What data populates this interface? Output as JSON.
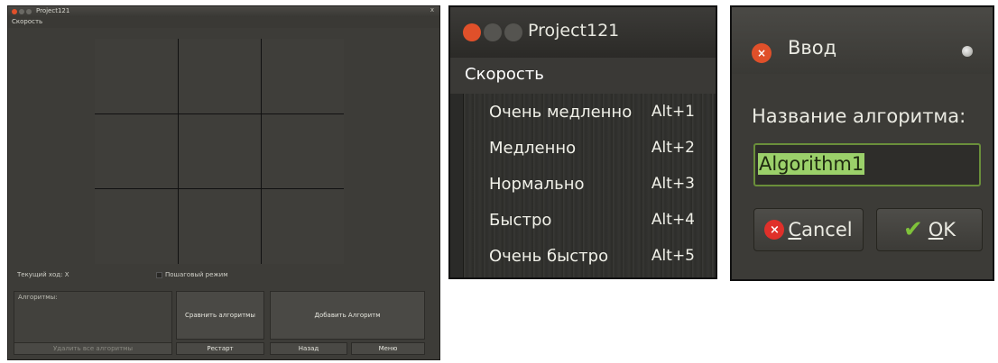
{
  "main_window": {
    "title": "Project121",
    "title_right": "x",
    "menu": "Скорость",
    "current_move": "Текущий ход: X",
    "step_mode": "Пошаговый режим",
    "algorithms_label": "Алгоритмы:",
    "buttons": {
      "compare": "Сравнить алгоритмы",
      "add": "Добавить Алгоритм",
      "delete_all": "Удалить все алгоритмы",
      "restart": "Рестарт",
      "back": "Назад",
      "menu": "Меню"
    }
  },
  "speed_window": {
    "title": "Project121",
    "menu": "Скорость",
    "items": [
      {
        "label": "Очень медленно",
        "shortcut": "Alt+1"
      },
      {
        "label": "Медленно",
        "shortcut": "Alt+2"
      },
      {
        "label": "Нормально",
        "shortcut": "Alt+3"
      },
      {
        "label": "Быстро",
        "shortcut": "Alt+4"
      },
      {
        "label": "Очень быстро",
        "shortcut": "Alt+5"
      }
    ]
  },
  "input_dialog": {
    "title": "Ввод",
    "prompt": "Название алгоритма:",
    "value": "Algorithm1",
    "cancel_first": "C",
    "cancel_rest": "ancel",
    "ok_first": "O",
    "ok_rest": "K"
  },
  "colors": {
    "window_bg": "#3d3c38",
    "close_red": "#e0502a",
    "selection_green": "#9bd06a",
    "ok_green": "#7fc23a"
  }
}
